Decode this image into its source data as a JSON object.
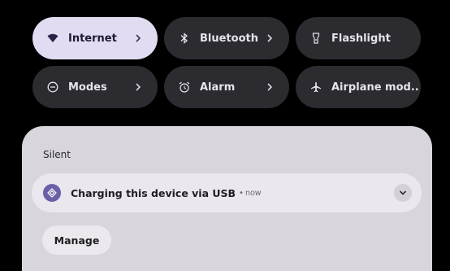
{
  "quick_settings": {
    "tiles": [
      {
        "label": "Internet",
        "icon": "wifi-icon",
        "state": "on",
        "has_chevron": true
      },
      {
        "label": "Bluetooth",
        "icon": "bluetooth-icon",
        "state": "off",
        "has_chevron": true
      },
      {
        "label": "Flashlight",
        "icon": "flashlight-icon",
        "state": "off",
        "has_chevron": false
      },
      {
        "label": "Modes",
        "icon": "modes-icon",
        "state": "off",
        "has_chevron": true
      },
      {
        "label": "Alarm",
        "icon": "alarm-icon",
        "state": "off",
        "has_chevron": true
      },
      {
        "label": "Airplane mod..",
        "icon": "airplane-icon",
        "state": "off",
        "has_chevron": false
      }
    ]
  },
  "notifications": {
    "section_title": "Silent",
    "items": [
      {
        "icon": "usb-icon",
        "title": "Charging this device via USB",
        "separator": "•",
        "time": "now"
      }
    ],
    "manage_label": "Manage"
  },
  "colors": {
    "background": "#000000",
    "tile_on": "#e1dcf2",
    "tile_off": "#2c2b30",
    "shade": "#d8d6dc",
    "notification_card": "#eae7ee",
    "app_icon": "#6b5fa8"
  }
}
